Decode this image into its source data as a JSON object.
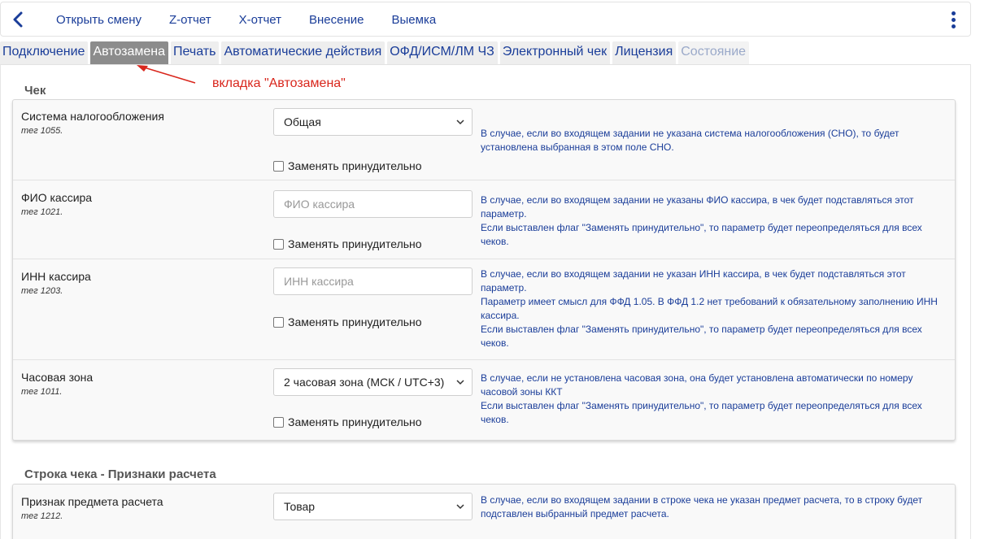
{
  "toolbar": {
    "items": [
      "Открыть смену",
      "Z-отчет",
      "X-отчет",
      "Внесение",
      "Выемка"
    ]
  },
  "tabs": [
    {
      "label": "Подключение",
      "state": "normal"
    },
    {
      "label": "Автозамена",
      "state": "active"
    },
    {
      "label": "Печать",
      "state": "normal"
    },
    {
      "label": "Автоматические действия",
      "state": "normal"
    },
    {
      "label": "ОФД/ИСМ/ЛМ ЧЗ",
      "state": "normal"
    },
    {
      "label": "Электронный чек",
      "state": "normal"
    },
    {
      "label": "Лицензия",
      "state": "normal"
    },
    {
      "label": "Состояние",
      "state": "disabled"
    }
  ],
  "annotation": "вкладка \"Автозамена\"",
  "sections": [
    {
      "title": "Чек",
      "rows": [
        {
          "label": "Система налогообложения",
          "tag": "тег 1055.",
          "control": "select",
          "value": "Общая",
          "checkbox_label": "Заменять принудительно",
          "help": [
            "В случае, если во входящем задании не указана система налогообложения (СНО), то будет установлена выбранная в этом поле СНО."
          ]
        },
        {
          "label": "ФИО кассира",
          "tag": "тег 1021.",
          "control": "input",
          "placeholder": "ФИО кассира",
          "checkbox_label": "Заменять принудительно",
          "help": [
            "В случае, если во входящем задании не указаны ФИО кассира, в чек будет подставляться этот параметр.",
            "Если выставлен флаг \"Заменять принудительно\", то параметр будет переопределяться для всех чеков."
          ]
        },
        {
          "label": "ИНН кассира",
          "tag": "тег 1203.",
          "control": "input",
          "placeholder": "ИНН кассира",
          "checkbox_label": "Заменять принудительно",
          "help": [
            "В случае, если во входящем задании не указан ИНН кассира, в чек будет подставляться этот параметр.",
            "Параметр имеет смысл для ФФД 1.05. В ФФД 1.2 нет требований к обязательному заполнению ИНН кассира.",
            "Если выставлен флаг \"Заменять принудительно\", то параметр будет переопределяться для всех чеков."
          ]
        },
        {
          "label": "Часовая зона",
          "tag": "тег 1011.",
          "control": "select",
          "value": "2 часовая зона (МСК / UTC+3)",
          "checkbox_label": "Заменять принудительно",
          "help": [
            "В случае, если не установлена часовая зона, она будет установлена автоматически по номеру часовой зоны ККТ",
            "Если выставлен флаг \"Заменять принудительно\", то параметр будет переопределяться для всех чеков."
          ]
        }
      ]
    },
    {
      "title": "Строка чека - Признаки расчета",
      "rows": [
        {
          "label": "Признак предмета расчета",
          "tag": "тег 1212.",
          "control": "select",
          "value": "Товар",
          "help": [
            "В случае, если во входящем задании в строке чека не указан предмет расчета, то в строку будет подставлен выбранный предмет расчета."
          ]
        }
      ]
    }
  ],
  "colors": {
    "link": "#1a3d99",
    "active_tab_bg": "#8c8c8c",
    "annotation": "#d9261c"
  },
  "icons": [
    "back-chevron-icon",
    "kebab-menu-icon",
    "chevron-down-icon"
  ]
}
